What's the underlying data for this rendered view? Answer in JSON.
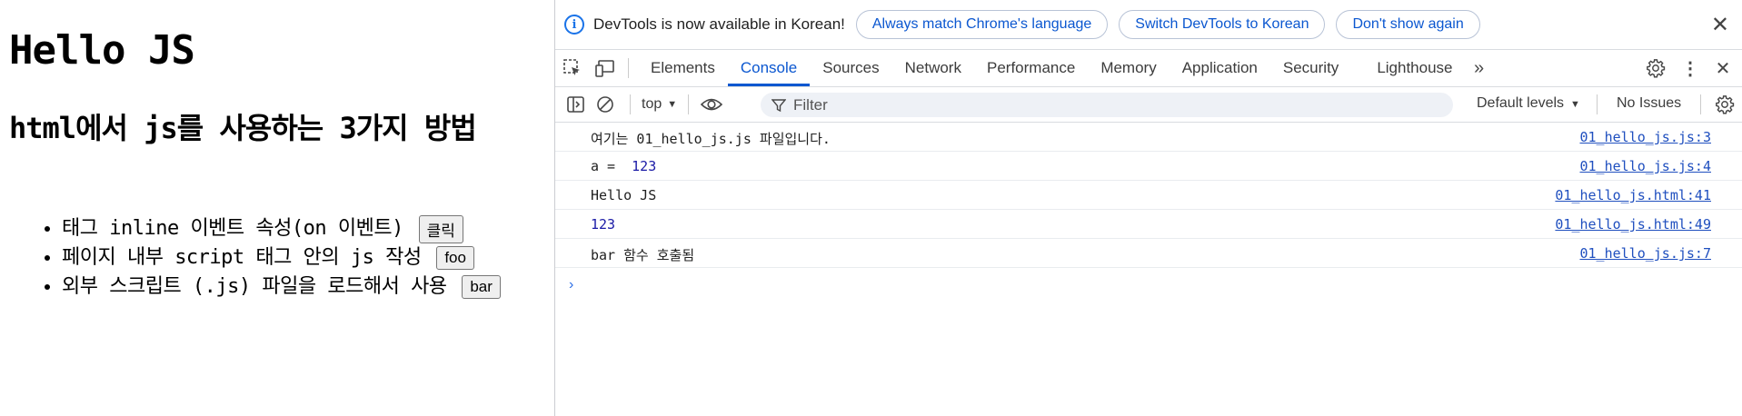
{
  "page": {
    "h1": "Hello JS",
    "h2": "html에서 js를 사용하는 3가지 방법",
    "items": [
      {
        "text": "태그 inline 이벤트 속성(on 이벤트)",
        "button": "클릭"
      },
      {
        "text": "페이지 내부 script 태그 안의 js 작성",
        "button": "foo"
      },
      {
        "text": "외부 스크립트 (.js) 파일을 로드해서 사용",
        "button": "bar"
      }
    ]
  },
  "devtools": {
    "infobar": {
      "message": "DevTools is now available in Korean!",
      "btn_match": "Always match Chrome's language",
      "btn_switch": "Switch DevTools to Korean",
      "btn_dont": "Don't show again"
    },
    "tabs": [
      "Elements",
      "Console",
      "Sources",
      "Network",
      "Performance",
      "Memory",
      "Application",
      "Security",
      "Lighthouse"
    ],
    "active_tab": "Console",
    "toolbar": {
      "context": "top",
      "filter_placeholder": "Filter",
      "levels": "Default levels",
      "issues": "No Issues"
    },
    "console": [
      {
        "msg": "여기는 01_hello_js.js 파일입니다.",
        "src": "01_hello_js.js:3"
      },
      {
        "msg_label": "a = ",
        "msg_value": "123",
        "src": "01_hello_js.js:4"
      },
      {
        "msg": "Hello JS",
        "src": "01_hello_js.html:41"
      },
      {
        "msg_number": "123",
        "src": "01_hello_js.html:49"
      },
      {
        "msg": "bar 함수 호출됨",
        "src": "01_hello_js.js:7"
      }
    ]
  },
  "colors": {
    "accent": "#0b57d0",
    "number": "#1a1aa6",
    "link": "#1f4fbf"
  }
}
